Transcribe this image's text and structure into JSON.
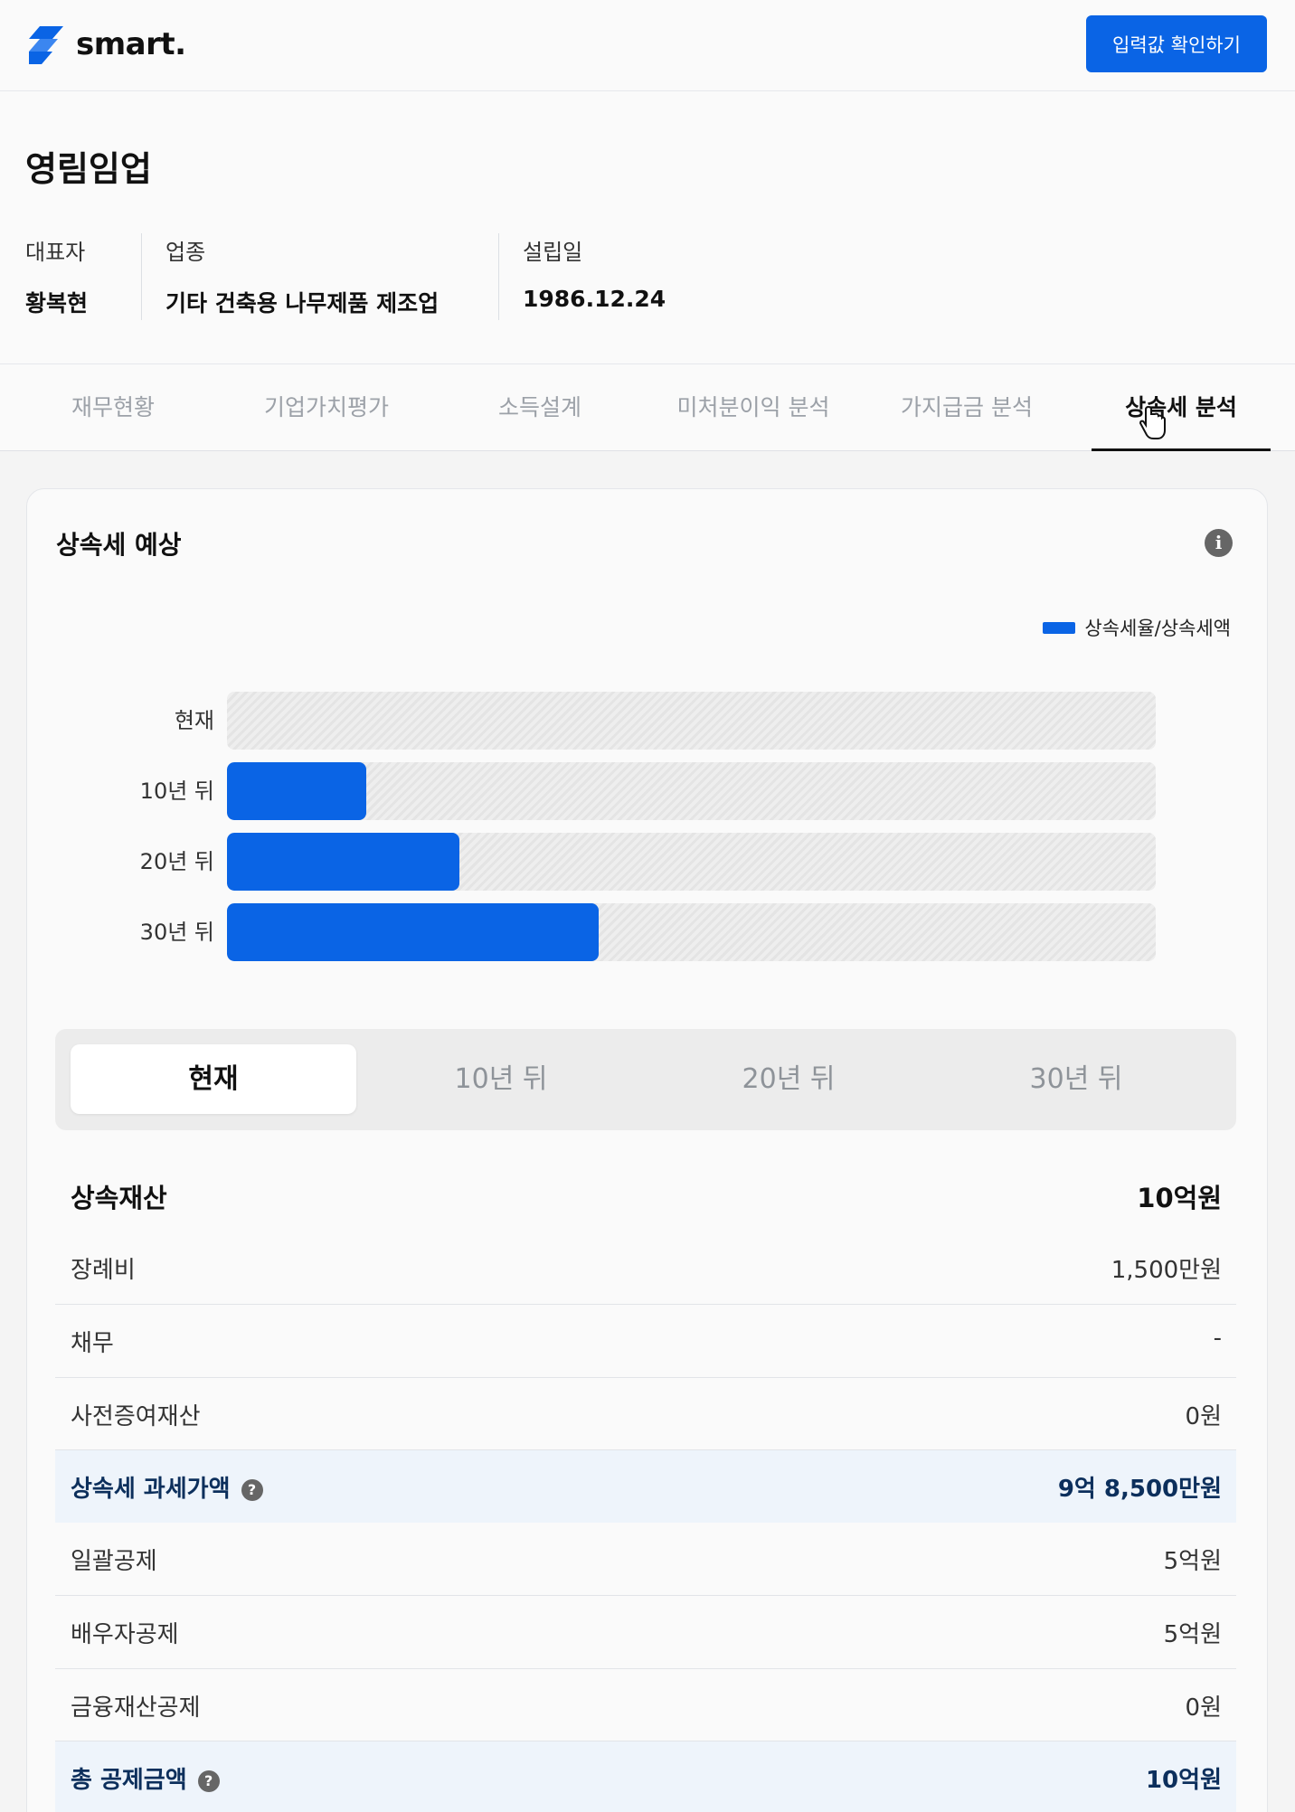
{
  "header": {
    "logo_text": "smart.",
    "confirm_button": "입력값 확인하기"
  },
  "company": {
    "name": "영림임업",
    "representative_label": "대표자",
    "representative": "황복현",
    "industry_label": "업종",
    "industry": "기타 건축용 나무제품 제조업",
    "founded_label": "설립일",
    "founded": "1986.12.24"
  },
  "tabs": [
    {
      "label": "재무현황"
    },
    {
      "label": "기업가치평가"
    },
    {
      "label": "소득설계"
    },
    {
      "label": "미처분이익 분석"
    },
    {
      "label": "가지급금 분석"
    },
    {
      "label": "상속세 분석"
    }
  ],
  "active_tab": "상속세 분석",
  "card": {
    "title": "상속세 예상",
    "legend": "상속세율/상속세액"
  },
  "chart_data": {
    "type": "bar",
    "orientation": "horizontal",
    "categories": [
      "현재",
      "10년 뒤",
      "20년 뒤",
      "30년 뒤"
    ],
    "series": [
      {
        "name": "상속세율/상속세액",
        "values": [
          0,
          0.15,
          0.25,
          0.4
        ]
      }
    ],
    "xlim": [
      0,
      1
    ],
    "colors": {
      "bar": "#0a64e5",
      "track": "#e8e8e8"
    }
  },
  "periods": {
    "active": "현재",
    "options": [
      "현재",
      "10년 뒤",
      "20년 뒤",
      "30년 뒤"
    ]
  },
  "table": {
    "inheritance_assets": {
      "label": "상속재산",
      "value": "10억원"
    },
    "funeral": {
      "label": "장례비",
      "value": "1,500만원"
    },
    "debt": {
      "label": "채무",
      "value": "-"
    },
    "prior_gift": {
      "label": "사전증여재산",
      "value": "0원"
    },
    "taxable": {
      "label": "상속세 과세가액",
      "value": "9억 8,500만원"
    },
    "lump_deduction": {
      "label": "일괄공제",
      "value": "5억원"
    },
    "spouse_deduction": {
      "label": "배우자공제",
      "value": "5억원"
    },
    "financial_deduction": {
      "label": "금융재산공제",
      "value": "0원"
    },
    "total_deduction": {
      "label": "총 공제금액",
      "value": "10억원"
    }
  },
  "colors": {
    "primary": "#0a64e5",
    "highlight_bg": "#eef4fb",
    "highlight_text": "#0c2f5c"
  }
}
